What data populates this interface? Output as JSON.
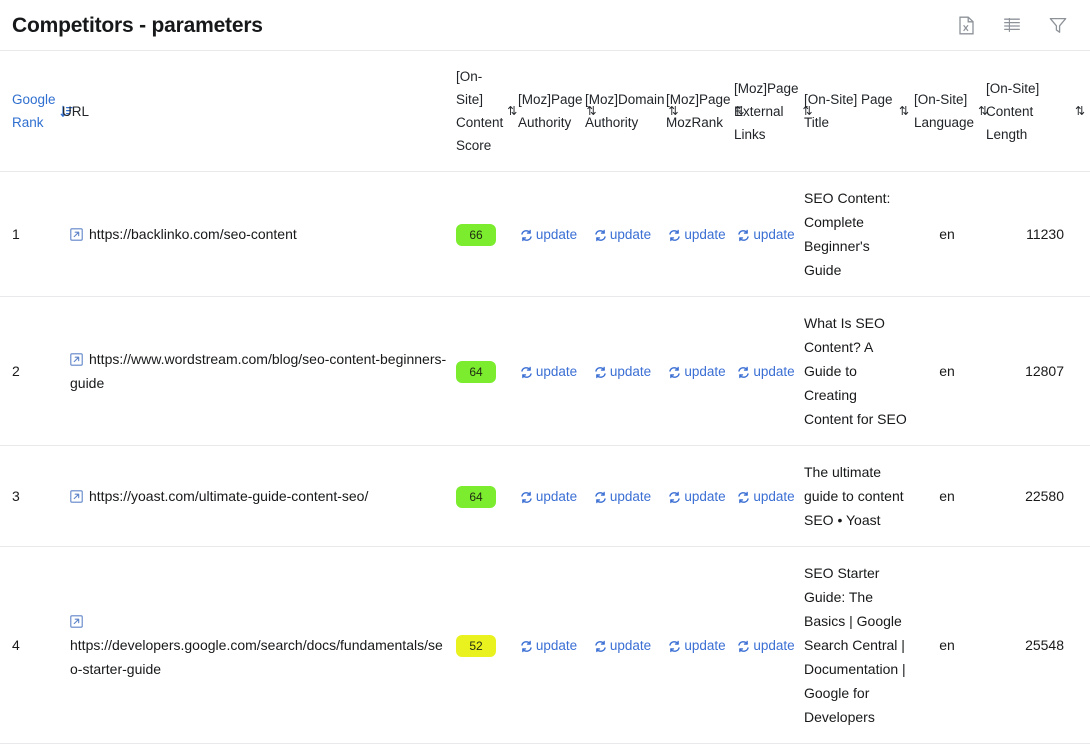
{
  "header": {
    "title": "Competitors - parameters",
    "actions": [
      {
        "name": "export-file-icon",
        "label": "Export"
      },
      {
        "name": "columns-icon",
        "label": "Columns"
      },
      {
        "name": "filter-icon",
        "label": "Filter"
      }
    ]
  },
  "table": {
    "columns": [
      {
        "key": "rank",
        "label": "Google Rank",
        "sortable": true,
        "sorted": "asc"
      },
      {
        "key": "url",
        "label": "URL",
        "sortable": false
      },
      {
        "key": "score",
        "label": "[On-Site] Content Score",
        "sortable": true
      },
      {
        "key": "pa",
        "label": "[Moz]Page Authority",
        "sortable": true
      },
      {
        "key": "da",
        "label": "[Moz]Domain Authority",
        "sortable": true
      },
      {
        "key": "mr",
        "label": "[Moz]Page MozRank",
        "sortable": true
      },
      {
        "key": "el",
        "label": "[Moz]Page External Links",
        "sortable": true
      },
      {
        "key": "title",
        "label": "[On-Site] Page Title",
        "sortable": true
      },
      {
        "key": "lang",
        "label": "[On-Site] Language",
        "sortable": true
      },
      {
        "key": "len",
        "label": "[On-Site] Content Length",
        "sortable": true
      }
    ],
    "update_label": "update",
    "rows": [
      {
        "rank": "1",
        "url": "https://backlinko.com/seo-content",
        "score": "66",
        "score_color": "#7CEC2E",
        "pa": "update",
        "da": "update",
        "mr": "update",
        "el": "update",
        "title": "SEO Content: Complete Beginner's Guide",
        "lang": "en",
        "len": "11230"
      },
      {
        "rank": "2",
        "url": "https://www.wordstream.com/blog/seo-content-beginners-guide",
        "score": "64",
        "score_color": "#7CEC2E",
        "pa": "update",
        "da": "update",
        "mr": "update",
        "el": "update",
        "title": "What Is SEO Content? A Guide to Creating Content for SEO",
        "lang": "en",
        "len": "12807"
      },
      {
        "rank": "3",
        "url": "https://yoast.com/ultimate-guide-content-seo/",
        "score": "64",
        "score_color": "#7CEC2E",
        "pa": "update",
        "da": "update",
        "mr": "update",
        "el": "update",
        "title": "The ultimate guide to content SEO • Yoast",
        "lang": "en",
        "len": "22580"
      },
      {
        "rank": "4",
        "url": "https://developers.google.com/search/docs/fundamentals/seo-starter-guide",
        "score": "52",
        "score_color": "#E9F21E",
        "pa": "update",
        "da": "update",
        "mr": "update",
        "el": "update",
        "title": "SEO Starter Guide: The Basics | Google Search Central | Documentation | Google for Developers",
        "lang": "en",
        "len": "25548"
      }
    ]
  },
  "colors": {
    "link": "#3b6fd4",
    "sorted_header": "#2f6fd0",
    "border": "#e9e9ec",
    "text": "#17181a"
  }
}
